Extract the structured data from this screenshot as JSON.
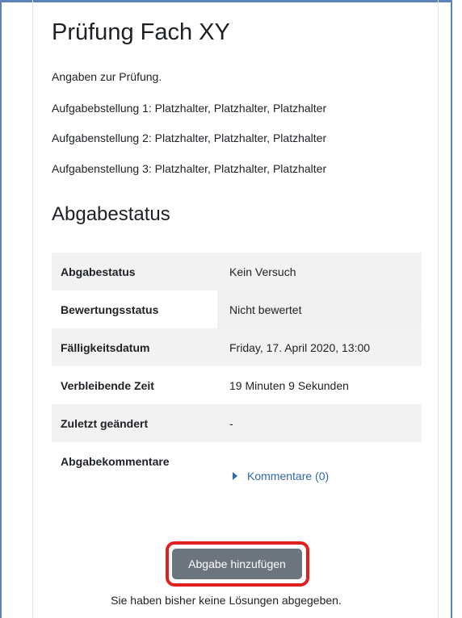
{
  "page": {
    "title": "Prüfung Fach XY",
    "intro": "Angaben zur Prüfung.",
    "tasks": [
      "Aufgabebstellung 1: Platzhalter, Platzhalter, Platzhalter",
      "Aufgabenstellung 2: Platzhalter, Platzhalter, Platzhalter",
      "Aufgabenstellung 3: Platzhalter, Platzhalter, Platzhalter"
    ]
  },
  "status": {
    "heading": "Abgabestatus",
    "rows": [
      {
        "label": "Abgabestatus",
        "value": "Kein Versuch"
      },
      {
        "label": "Bewertungsstatus",
        "value": "Nicht bewertet"
      },
      {
        "label": "Fälligkeitsdatum",
        "value": "Friday, 17. April 2020, 13:00"
      },
      {
        "label": "Verbleibende Zeit",
        "value": "19 Minuten 9 Sekunden"
      },
      {
        "label": "Zuletzt geändert",
        "value": "-"
      },
      {
        "label": "Abgabekommentare",
        "value": ""
      }
    ],
    "comments_link": "Kommentare (0)"
  },
  "actions": {
    "add_submission": "Abgabe hinzufügen",
    "hint": "Sie haben bisher keine Lösungen abgegeben."
  },
  "colors": {
    "frame": "#5b83b7",
    "button": "#6c757d",
    "highlight": "#e0201c",
    "link": "#2f6aa8"
  }
}
